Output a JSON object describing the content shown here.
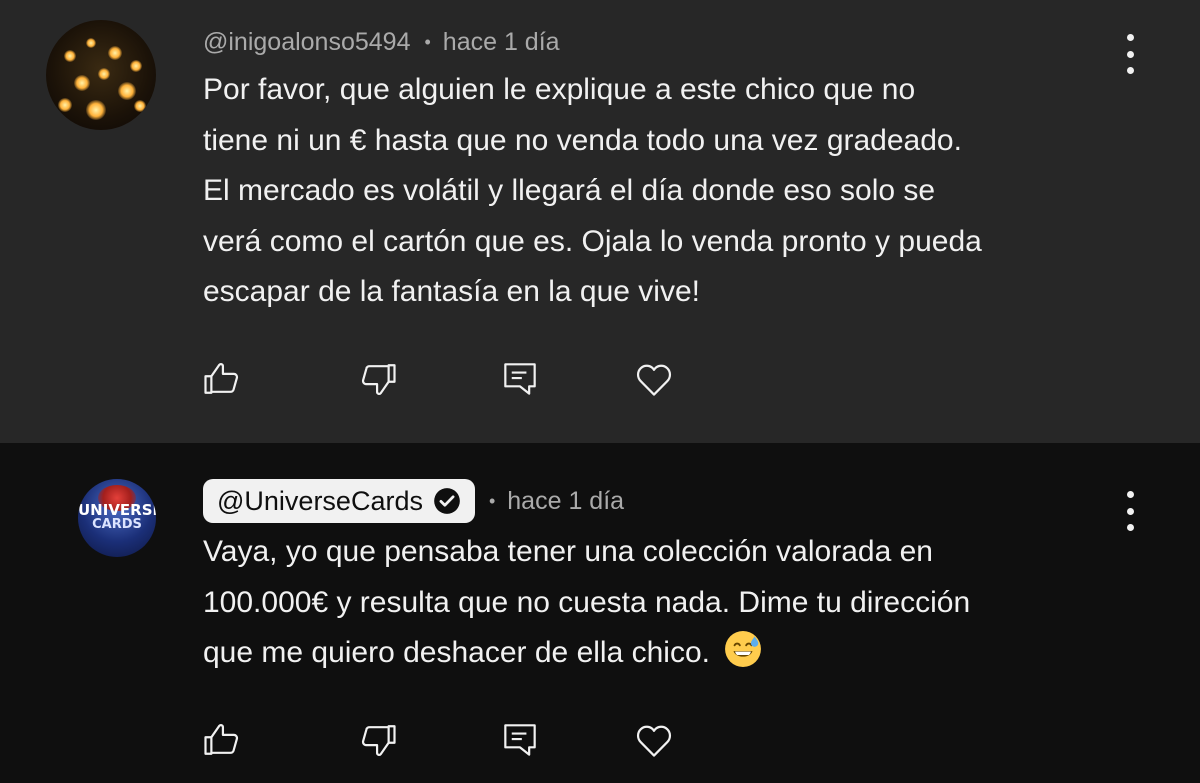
{
  "comments": [
    {
      "author": "@inigoalonso5494",
      "separator": "•",
      "time": "hace 1 día",
      "verified": false,
      "text": "Por favor, que alguien le explique a este chico que no\ntiene ni un € hasta que no venda todo una vez gradeado.\nEl mercado es volátil y llegará el día donde eso solo se\nverá como el cartón que es. Ojala lo venda pronto y pueda\nescapar de la fantasía en la que vive!",
      "avatar_icon": "lanterns-photo-avatar"
    },
    {
      "author": "@UniverseCards",
      "separator": "•",
      "time": "hace 1 día",
      "verified": true,
      "text": "Vaya, yo que pensaba tener una colección valorada en\n100.000€ y resulta que no cuesta nada. Dime tu dirección\nque me quiero deshacer de ella chico. ",
      "emoji": "grinning-face-with-sweat-emoji",
      "avatar_icon": "universe-cards-logo",
      "avatar_text": [
        "UNIVERSE",
        "CARDS"
      ]
    }
  ],
  "actions": {
    "like": "thumbs-up-icon",
    "dislike": "thumbs-down-icon",
    "reply": "reply-comment-icon",
    "heart": "heart-icon"
  },
  "colors": {
    "highlighted_bg": "#272727",
    "page_bg": "#0f0f0f",
    "text": "#f1f1f1",
    "meta": "#aaaaaa",
    "chip_bg": "#f1f1f1"
  }
}
